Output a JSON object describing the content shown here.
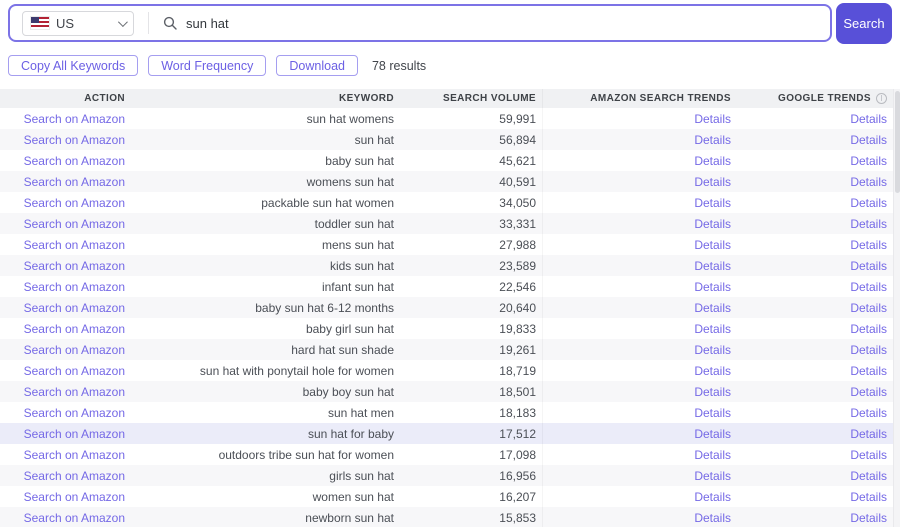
{
  "colors": {
    "accent_purple": "#6c60e4",
    "link_purple": "#7569e6",
    "search_button_bg": "#5850d8",
    "searchbar_border": "#7c73e6",
    "header_bg": "#f0f1f3",
    "stripe_bg": "#f7f7f9",
    "highlight_row_bg": "#ebecf9"
  },
  "search_bar": {
    "country": {
      "label": "US",
      "flag": "us-flag-icon"
    },
    "query": "sun hat",
    "search_button_label": "Search",
    "search_icon": "magnifier-icon",
    "chevron_icon": "chevron-down-icon"
  },
  "toolbar": {
    "copy_all_label": "Copy All Keywords",
    "word_frequency_label": "Word Frequency",
    "download_label": "Download",
    "results_count": "78 results"
  },
  "table": {
    "headers": {
      "action": "ACTION",
      "keyword": "KEYWORD",
      "search_volume": "SEARCH VOLUME",
      "amazon_trends": "AMAZON SEARCH TRENDS",
      "google_trends": "GOOGLE TRENDS"
    },
    "google_trends_info_icon": "info-icon",
    "action_label": "Search on Amazon",
    "details_label": "Details",
    "rows": [
      {
        "keyword": "sun hat womens",
        "search_volume": "59,991",
        "highlighted": false
      },
      {
        "keyword": "sun hat",
        "search_volume": "56,894",
        "highlighted": false
      },
      {
        "keyword": "baby sun hat",
        "search_volume": "45,621",
        "highlighted": false
      },
      {
        "keyword": "womens sun hat",
        "search_volume": "40,591",
        "highlighted": false
      },
      {
        "keyword": "packable sun hat women",
        "search_volume": "34,050",
        "highlighted": false
      },
      {
        "keyword": "toddler sun hat",
        "search_volume": "33,331",
        "highlighted": false
      },
      {
        "keyword": "mens sun hat",
        "search_volume": "27,988",
        "highlighted": false
      },
      {
        "keyword": "kids sun hat",
        "search_volume": "23,589",
        "highlighted": false
      },
      {
        "keyword": "infant sun hat",
        "search_volume": "22,546",
        "highlighted": false
      },
      {
        "keyword": "baby sun hat 6-12 months",
        "search_volume": "20,640",
        "highlighted": false
      },
      {
        "keyword": "baby girl sun hat",
        "search_volume": "19,833",
        "highlighted": false
      },
      {
        "keyword": "hard hat sun shade",
        "search_volume": "19,261",
        "highlighted": false
      },
      {
        "keyword": "sun hat with ponytail hole for women",
        "search_volume": "18,719",
        "highlighted": false
      },
      {
        "keyword": "baby boy sun hat",
        "search_volume": "18,501",
        "highlighted": false
      },
      {
        "keyword": "sun hat men",
        "search_volume": "18,183",
        "highlighted": false
      },
      {
        "keyword": "sun hat for baby",
        "search_volume": "17,512",
        "highlighted": true
      },
      {
        "keyword": "outdoors tribe sun hat for women",
        "search_volume": "17,098",
        "highlighted": false
      },
      {
        "keyword": "girls sun hat",
        "search_volume": "16,956",
        "highlighted": false
      },
      {
        "keyword": "women sun hat",
        "search_volume": "16,207",
        "highlighted": false
      },
      {
        "keyword": "newborn sun hat",
        "search_volume": "15,853",
        "highlighted": false
      }
    ]
  }
}
